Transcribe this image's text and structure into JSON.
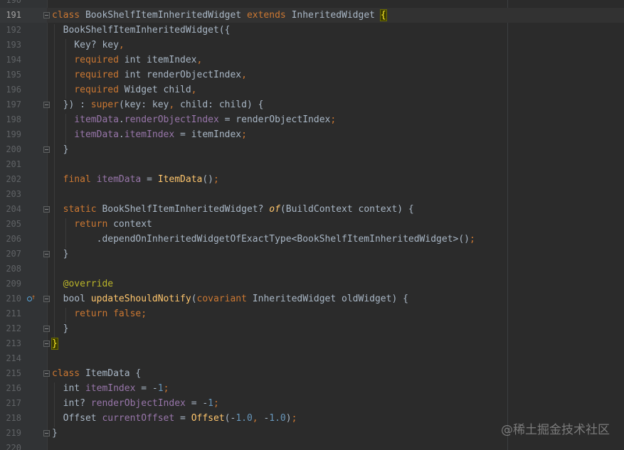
{
  "editor": {
    "theme": "darcula",
    "colors": {
      "background": "#2B2B2B",
      "keyword": "#CC7832",
      "function": "#FFC66D",
      "field": "#9876AA",
      "number": "#6897BB",
      "annotation": "#BBB529",
      "text": "#A9B7C6"
    },
    "active_line_number": "191",
    "gutter_icon": "overridden-method-icon",
    "lines": [
      {
        "n": "190",
        "t": []
      },
      {
        "n": "191",
        "t": [
          {
            "c": "k",
            "v": "class "
          },
          {
            "c": "n",
            "v": "BookShelfItemInheritedWidget "
          },
          {
            "c": "k",
            "v": "extends "
          },
          {
            "c": "n",
            "v": "InheritedWidget "
          },
          {
            "c": "brace-hl",
            "v": "{"
          }
        ]
      },
      {
        "n": "192",
        "t": [
          {
            "c": "n",
            "v": "  BookShelfItemInheritedWidget({"
          }
        ]
      },
      {
        "n": "193",
        "t": [
          {
            "c": "n",
            "v": "    Key? key"
          },
          {
            "c": "k",
            "v": ","
          }
        ]
      },
      {
        "n": "194",
        "t": [
          {
            "c": "k",
            "v": "    required "
          },
          {
            "c": "n",
            "v": "int itemIndex"
          },
          {
            "c": "k",
            "v": ","
          }
        ]
      },
      {
        "n": "195",
        "t": [
          {
            "c": "k",
            "v": "    required "
          },
          {
            "c": "n",
            "v": "int renderObjectIndex"
          },
          {
            "c": "k",
            "v": ","
          }
        ]
      },
      {
        "n": "196",
        "t": [
          {
            "c": "k",
            "v": "    required "
          },
          {
            "c": "n",
            "v": "Widget child"
          },
          {
            "c": "k",
            "v": ","
          }
        ]
      },
      {
        "n": "197",
        "t": [
          {
            "c": "n",
            "v": "  }) : "
          },
          {
            "c": "k",
            "v": "super"
          },
          {
            "c": "n",
            "v": "(key: key"
          },
          {
            "c": "k",
            "v": ", "
          },
          {
            "c": "n",
            "v": "child: child) {"
          }
        ]
      },
      {
        "n": "198",
        "t": [
          {
            "c": "p",
            "v": "    itemData"
          },
          {
            "c": "n",
            "v": "."
          },
          {
            "c": "p",
            "v": "renderObjectIndex "
          },
          {
            "c": "n",
            "v": "= renderObjectIndex"
          },
          {
            "c": "k",
            "v": ";"
          }
        ]
      },
      {
        "n": "199",
        "t": [
          {
            "c": "p",
            "v": "    itemData"
          },
          {
            "c": "n",
            "v": "."
          },
          {
            "c": "p",
            "v": "itemIndex "
          },
          {
            "c": "n",
            "v": "= itemIndex"
          },
          {
            "c": "k",
            "v": ";"
          }
        ]
      },
      {
        "n": "200",
        "t": [
          {
            "c": "n",
            "v": "  }"
          }
        ]
      },
      {
        "n": "201",
        "t": []
      },
      {
        "n": "202",
        "t": [
          {
            "c": "k",
            "v": "  final "
          },
          {
            "c": "p",
            "v": "itemData "
          },
          {
            "c": "n",
            "v": "= "
          },
          {
            "c": "f",
            "v": "ItemData"
          },
          {
            "c": "n",
            "v": "()"
          },
          {
            "c": "k",
            "v": ";"
          }
        ]
      },
      {
        "n": "203",
        "t": []
      },
      {
        "n": "204",
        "t": [
          {
            "c": "k",
            "v": "  static "
          },
          {
            "c": "n",
            "v": "BookShelfItemInheritedWidget? "
          },
          {
            "c": "it",
            "v": "of"
          },
          {
            "c": "n",
            "v": "(BuildContext context) {"
          }
        ]
      },
      {
        "n": "205",
        "t": [
          {
            "c": "k",
            "v": "    return "
          },
          {
            "c": "n",
            "v": "context"
          }
        ]
      },
      {
        "n": "206",
        "t": [
          {
            "c": "n",
            "v": "        .dependOnInheritedWidgetOfExactType<BookShelfItemInheritedWidget>()"
          },
          {
            "c": "k",
            "v": ";"
          }
        ]
      },
      {
        "n": "207",
        "t": [
          {
            "c": "n",
            "v": "  }"
          }
        ]
      },
      {
        "n": "208",
        "t": []
      },
      {
        "n": "209",
        "t": [
          {
            "c": "a",
            "v": "  @override"
          }
        ]
      },
      {
        "n": "210",
        "t": [
          {
            "c": "n",
            "v": "  bool "
          },
          {
            "c": "f",
            "v": "updateShouldNotify"
          },
          {
            "c": "n",
            "v": "("
          },
          {
            "c": "k",
            "v": "covariant "
          },
          {
            "c": "n",
            "v": "InheritedWidget oldWidget) {"
          }
        ]
      },
      {
        "n": "211",
        "t": [
          {
            "c": "k",
            "v": "    return false;"
          }
        ]
      },
      {
        "n": "212",
        "t": [
          {
            "c": "n",
            "v": "  }"
          }
        ]
      },
      {
        "n": "213",
        "t": [
          {
            "c": "brace-hl",
            "v": "}"
          }
        ]
      },
      {
        "n": "214",
        "t": []
      },
      {
        "n": "215",
        "t": [
          {
            "c": "k",
            "v": "class "
          },
          {
            "c": "n",
            "v": "ItemData {"
          }
        ]
      },
      {
        "n": "216",
        "t": [
          {
            "c": "n",
            "v": "  int "
          },
          {
            "c": "p",
            "v": "itemIndex "
          },
          {
            "c": "n",
            "v": "= -"
          },
          {
            "c": "num",
            "v": "1"
          },
          {
            "c": "k",
            "v": ";"
          }
        ]
      },
      {
        "n": "217",
        "t": [
          {
            "c": "n",
            "v": "  int? "
          },
          {
            "c": "p",
            "v": "renderObjectIndex "
          },
          {
            "c": "n",
            "v": "= -"
          },
          {
            "c": "num",
            "v": "1"
          },
          {
            "c": "k",
            "v": ";"
          }
        ]
      },
      {
        "n": "218",
        "t": [
          {
            "c": "n",
            "v": "  Offset "
          },
          {
            "c": "p",
            "v": "currentOffset "
          },
          {
            "c": "n",
            "v": "= "
          },
          {
            "c": "f",
            "v": "Offset"
          },
          {
            "c": "n",
            "v": "(-"
          },
          {
            "c": "num",
            "v": "1.0"
          },
          {
            "c": "k",
            "v": ", "
          },
          {
            "c": "n",
            "v": "-"
          },
          {
            "c": "num",
            "v": "1.0"
          },
          {
            "c": "n",
            "v": ")"
          },
          {
            "c": "k",
            "v": ";"
          }
        ]
      },
      {
        "n": "219",
        "t": [
          {
            "c": "n",
            "v": "}"
          }
        ]
      },
      {
        "n": "220",
        "t": []
      }
    ]
  },
  "watermark": "@稀土掘金技术社区"
}
